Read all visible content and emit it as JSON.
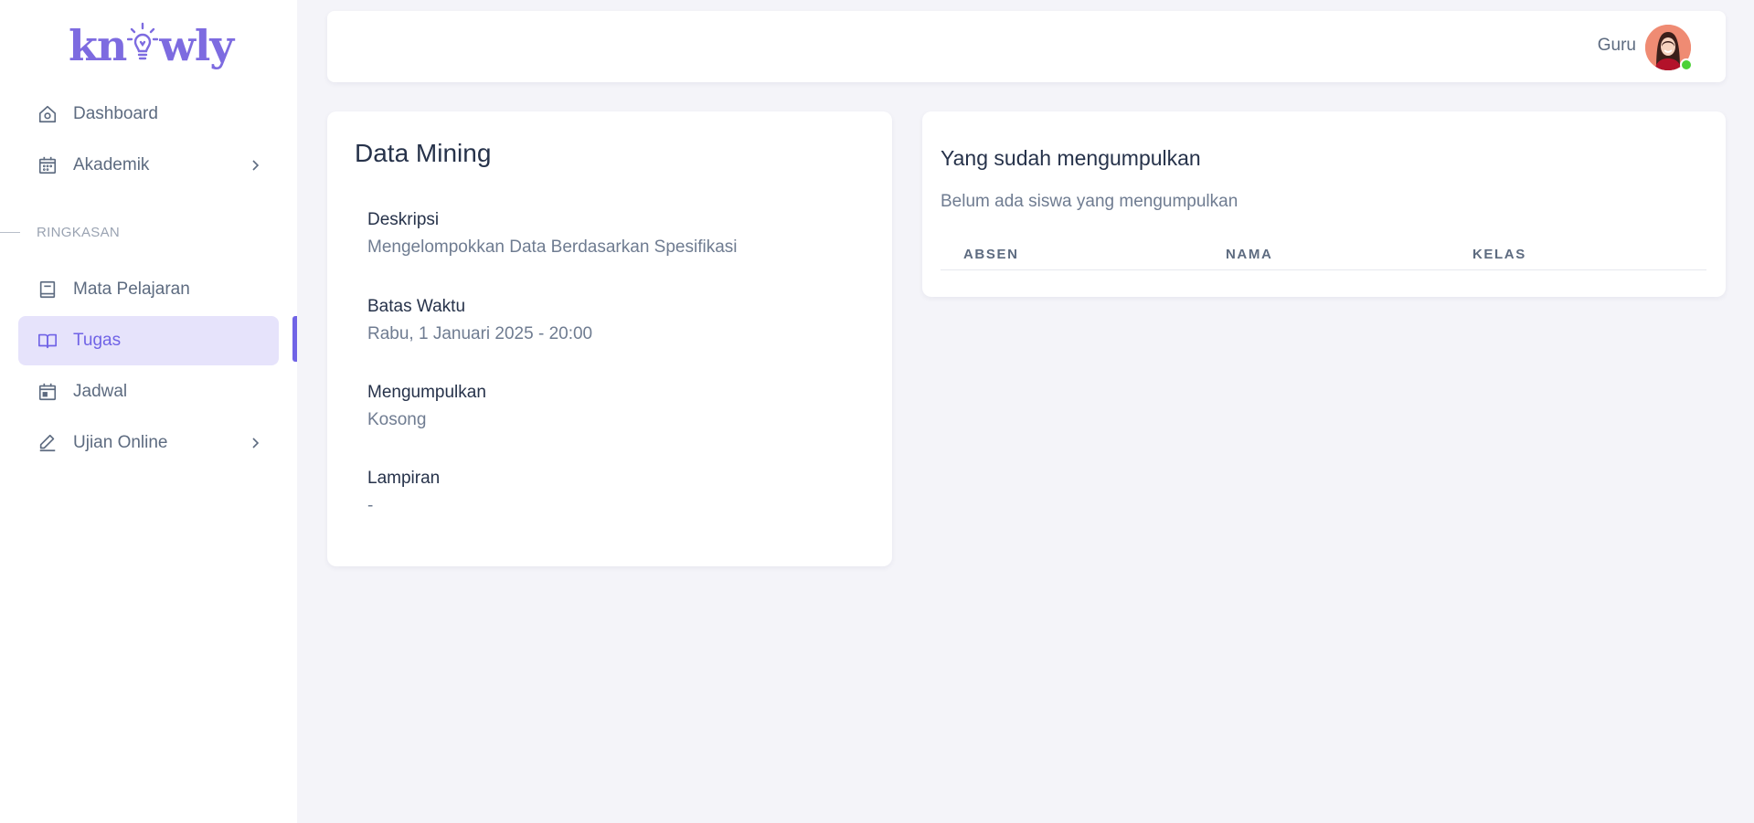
{
  "brand": {
    "logo_left": "kn",
    "logo_right": "wly",
    "color": "#7d6be0"
  },
  "sidebar": {
    "top_items": [
      {
        "label": "Dashboard",
        "icon": "home-icon"
      },
      {
        "label": "Akademik",
        "icon": "calendar-icon",
        "has_submenu": true
      }
    ],
    "section_label": "RINGKASAN",
    "items": [
      {
        "label": "Mata Pelajaran",
        "icon": "book-icon"
      },
      {
        "label": "Tugas",
        "icon": "open-book-icon",
        "active": true
      },
      {
        "label": "Jadwal",
        "icon": "calendar-day-icon"
      },
      {
        "label": "Ujian Online",
        "icon": "pencil-icon",
        "has_submenu": true
      }
    ]
  },
  "header": {
    "user_role": "Guru",
    "status": "online"
  },
  "detail": {
    "title": "Data Mining",
    "fields": [
      {
        "label": "Deskripsi",
        "value": "Mengelompokkan Data Berdasarkan Spesifikasi"
      },
      {
        "label": "Batas Waktu",
        "value": "Rabu, 1 Januari 2025 - 20:00"
      },
      {
        "label": "Mengumpulkan",
        "value": "Kosong"
      },
      {
        "label": "Lampiran",
        "value": "-"
      }
    ]
  },
  "submissions": {
    "title": "Yang sudah mengumpulkan",
    "empty_text": "Belum ada siswa yang mengumpulkan",
    "columns": [
      "ABSEN",
      "NAMA",
      "KELAS"
    ]
  },
  "colors": {
    "accent": "#7063e6",
    "active_bg": "#e6e3fb",
    "online": "#4cd137"
  }
}
